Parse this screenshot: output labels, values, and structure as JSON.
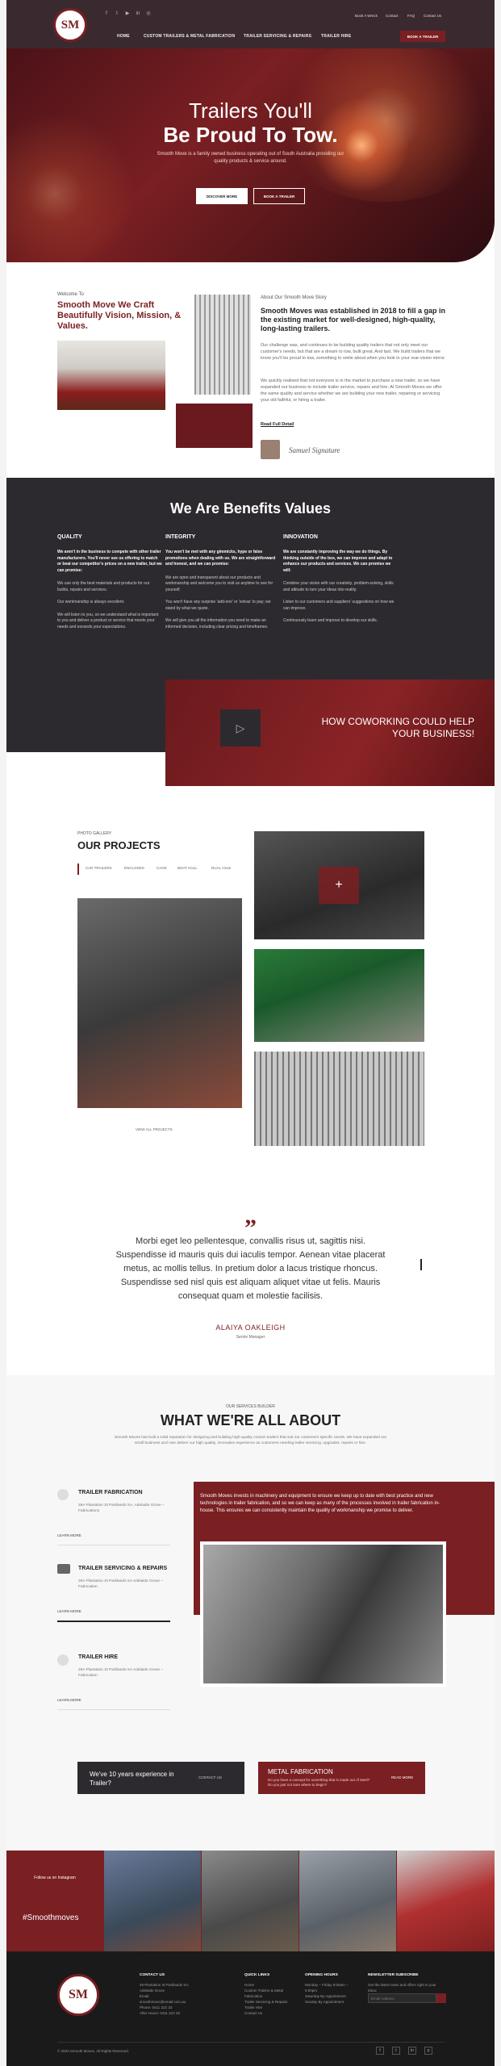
{
  "header": {
    "logo_text": "SM",
    "top_links": [
      "Book A Wreck",
      "Contact",
      "FAQ",
      "Contact Us"
    ],
    "nav": [
      "HOME",
      "CUSTOM TRAILERS & METAL FABRICATION",
      "TRAILER SERVICING & REPAIRS",
      "TRAILER HIRE"
    ],
    "cta": "BOOK A TRAILER"
  },
  "hero": {
    "line1": "Trailers You'll",
    "line2": "Be Proud To Tow.",
    "sub": "Smooth Move is a family owned business operating out of South Australia providing our quality products & service around.",
    "btn1": "DISCOVER MORE",
    "btn2": "BOOK A TRAILER"
  },
  "welcome": {
    "label": "Welcome To",
    "heading": "Smooth Move We Craft Beautifully Vision, Mission, & Values.",
    "story_label": "About Our Smooth Move Story",
    "story_heading": "Smooth Moves was established in 2018 to fill a gap in the existing market for well-designed, high-quality, long-lasting trailers.",
    "p1": "Our challenge was, and continues to be building quality trailers that not only meet our customer's needs, but that are a dream to tow, built great. And last. We build trailers that we know you'll be proud to tow, something to smile about when you look in your rear-vision mirror.",
    "p2": "We quickly realised that not everyone is in the market to purchase a new trailer, so we have expanded our business to include trailer service, repairs and hire. At Smooth Moves we offer the same quality and service whether we are building your new trailer, repairing or servicing your old faithful, or hiring a trailer.",
    "read_more": "Read Full Detail",
    "signature": "Samuel Signature"
  },
  "benefits": {
    "heading": "We Are Benefits Values",
    "cols": [
      {
        "title": "QUALITY",
        "lead": "We aren't in the business to compete with other trailer manufacturers. You'll never see us offering to match or beat our competitor's prices on a new trailer, but we can promise:",
        "p1": "We use only the best materials and products for our builds, repairs and services.",
        "p2": "Our workmanship is always excellent.",
        "p3": "We will listen to you, so we understand what is important to you and deliver a product or service that meets your needs and exceeds your expectations."
      },
      {
        "title": "INTEGRITY",
        "lead": "You won't be met with any gimmicks, hype or false promotions when dealing with us. We are straightforward and honest, and we can promise:",
        "p1": "We are open and transparent about our products and workmanship and welcome you to visit us anytime to see for yourself.",
        "p2": "You won't have any surprise 'add-ons' or 'extras' to pay; we stand by what we quote.",
        "p3": "We will give you all the information you need to make an informed decision, including clear pricing and timeframes."
      },
      {
        "title": "INNOVATION",
        "lead": "We are constantly improving the way we do things. By thinking outside of the box, we can improve and adapt to enhance our products and services. We can promise we will:",
        "p1": "Combine your vision with our creativity, problem-solving, skills and attitude to turn your ideas into reality.",
        "p2": "Listen to our customers and suppliers' suggestions on how we can improve.",
        "p3": "Continuously learn and improve to develop our skills."
      }
    ],
    "video_text": "HOW COWORKING COULD HELP YOUR BUSINESS!"
  },
  "projects": {
    "label": "PHOTO GALLERY",
    "heading": "OUR PROJECTS",
    "tabs": [
      "CAR TRAILERS",
      "ENCLOSED",
      "CAGE",
      "BOAT HULL",
      "DUAL AXLE"
    ],
    "view_all": "VIEW ALL PROJECTS"
  },
  "testimonial": {
    "quote_mark": "”",
    "text": "Morbi eget leo pellentesque, convallis risus ut, sagittis nisi. Suspendisse id mauris quis dui iaculis tempor. Aenean vitae placerat metus, ac mollis tellus. In pretium dolor a lacus tristique rhoncus. Suspendisse sed nisl quis est aliquam aliquet vitae ut felis. Mauris consequat quam et molestie facilisis.",
    "name": "ALAIYA OAKLEIGH",
    "role": "Senior Manager"
  },
  "services": {
    "label": "OUR SERVICES BUILDER",
    "heading": "WHAT WE'RE ALL ABOUT",
    "intro": "Smooth Moves has built a solid reputation for designing and building high-quality custom trailers that suit our customers specific needs. We have expanded our small business and now deliver our high quality, innovative experience as customers needing trailer servicing, upgrades, repairs or hire.",
    "items": [
      {
        "title": "TRAILER FABRICATION",
        "addr": "29A Plantation St Parklands SA, Adelaide Grove – Fabrications",
        "more": "LEARN MORE"
      },
      {
        "title": "TRAILER SERVICING & REPAIRS",
        "addr": "29A Plantation St Parklands SA Adelaide Grove – Fabrication",
        "more": "LEARN MORE"
      },
      {
        "title": "TRAILER HIRE",
        "addr": "29A Plantation St Parklands SA Adelaide Grove – Fabrication",
        "more": "LEARN MORE"
      }
    ],
    "feature_text": "Smooth Moves invests in machinery and equipment to ensure we keep up to date with best practice and new technologies in trailer fabrication, and so we can keep as many of the processes involved in trailer fabrication in-house. This ensures we can consistently maintain the quality of workmanship we promise to deliver.",
    "cta1_text": "We've 10 years experience in Trailer?",
    "cta1_btn": "CONTACT US",
    "cta2_title": "METAL FABRICATION",
    "cta2_text": "Do you have a concept for something that is made out of steel? Do you just not sure where to begin?",
    "cta2_btn": "READ MORE"
  },
  "instagram": {
    "label": "Follow us on Instagram",
    "tag": "#Smoothmoves"
  },
  "footer": {
    "contact_h": "CONTACT US",
    "contact": [
      "29 Plantation St Parklands SA, Adelaide Grove",
      "Email:",
      "smoothmove@email.com.au",
      "Phone: 0411 222 33",
      "After Hours: 0411 222 33"
    ],
    "links_h": "QUICK LINKS",
    "links": [
      "Home",
      "Custom Trailers & Metal Fabrication",
      "Trailer Servicing & Repairs",
      "Trailer Hire",
      "Contact Us"
    ],
    "hours_h": "OPENING HOURS",
    "hours": [
      "Monday – Friday 8:00am – 5:00pm",
      "Saturday By Appointment",
      "Sunday By Appointment"
    ],
    "news_h": "NEWSLETTER SUBSCRIBE",
    "news_text": "Get the latest news and offers right to your inbox",
    "news_placeholder": "Email Address",
    "copyright": "© 2023 Smooth Moves. All Rights Reserved."
  }
}
